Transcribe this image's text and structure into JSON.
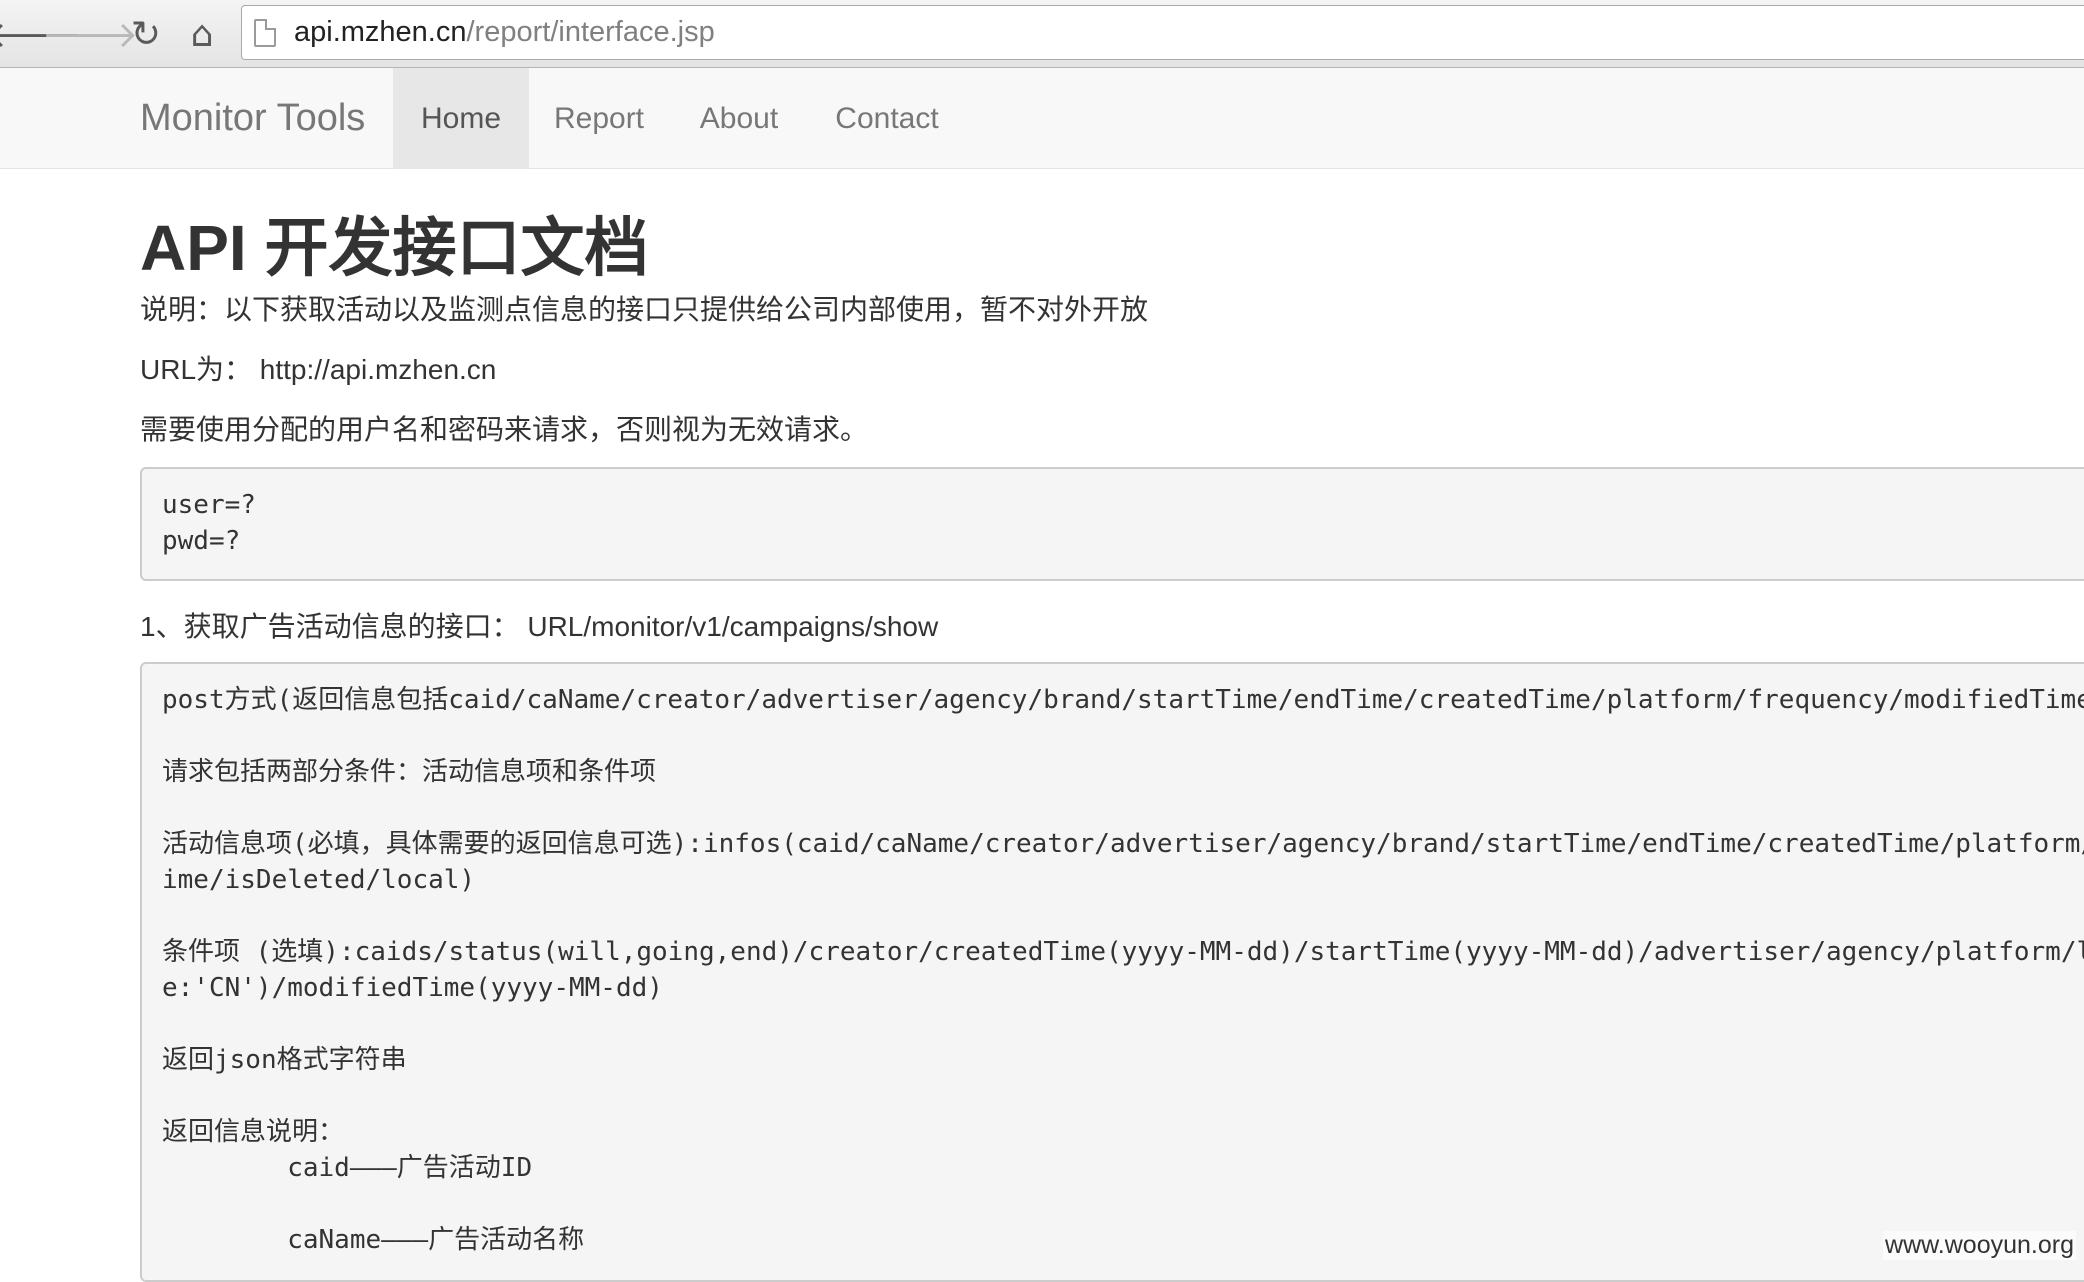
{
  "browser": {
    "back_glyph": "🡐",
    "forward_glyph": "🡒",
    "reload_glyph": "↻",
    "home_glyph": "⌂",
    "url_host": "api.mzhen.cn",
    "url_path": "/report/interface.jsp",
    "icons": [
      "back-arrow-icon",
      "forward-arrow-icon",
      "reload-icon",
      "home-icon",
      "page-icon"
    ]
  },
  "navbar": {
    "brand": "Monitor Tools",
    "items": [
      {
        "label": "Home",
        "active": true
      },
      {
        "label": "Report",
        "active": false
      },
      {
        "label": "About",
        "active": false
      },
      {
        "label": "Contact",
        "active": false
      }
    ]
  },
  "content": {
    "title": "API 开发接口文档",
    "description": "说明：以下获取活动以及监测点信息的接口只提供给公司内部使用，暂不对外开放",
    "url_line": "URL为：  http://api.mzhen.cn",
    "auth_note": "需要使用分配的用户名和密码来请求，否则视为无效请求。",
    "auth_code": "user=?\npwd=?",
    "section1_heading": "1、获取广告活动信息的接口：  URL/monitor/v1/campaigns/show",
    "section1_code": "post方式(返回信息包括caid/caName/creator/advertiser/agency/brand/startTime/endTime/createdTime/platform/frequency/modifiedTime\n\n请求包括两部分条件：活动信息项和条件项\n\n活动信息项(必填，具体需要的返回信息可选):infos(caid/caName/creator/advertiser/agency/brand/startTime/endTime/createdTime/platform/\nime/isDeleted/local)\n\n条件项 (选填):caids/status(will,going,end)/creator/createdTime(yyyy-MM-dd)/startTime(yyyy-MM-dd)/advertiser/agency/platform/l\ne:'CN')/modifiedTime(yyyy-MM-dd)\n\n返回json格式字符串\n\n返回信息说明：\n        caid———广告活动ID\n\n        caName———广告活动名称"
  },
  "watermark": "www.wooyun.org"
}
